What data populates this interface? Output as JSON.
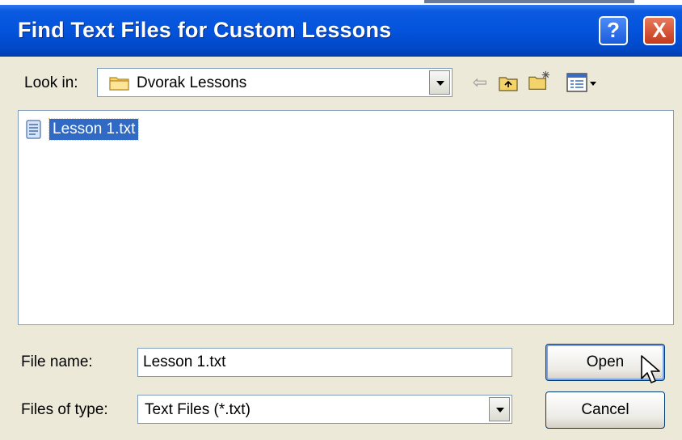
{
  "window": {
    "title": "Find Text Files for Custom Lessons"
  },
  "title_buttons": {
    "help": "?",
    "close": "X"
  },
  "look_in": {
    "label": "Look in:",
    "value": "Dvorak Lessons",
    "icon": "folder-icon"
  },
  "toolbar": {
    "icons": [
      "back-icon",
      "up-folder-icon",
      "new-folder-icon",
      "view-menu-icon"
    ]
  },
  "files": [
    {
      "name": "Lesson 1.txt",
      "icon": "text-file-icon",
      "selected": true
    }
  ],
  "file_name": {
    "label": "File name:",
    "value": "Lesson 1.txt"
  },
  "file_type": {
    "label": "Files of type:",
    "value": "Text Files (*.txt)"
  },
  "buttons": {
    "open": "Open",
    "cancel": "Cancel"
  },
  "colors": {
    "titlebar": "#0353dc",
    "selection": "#316ac5",
    "dialog_bg": "#ece9d8"
  }
}
